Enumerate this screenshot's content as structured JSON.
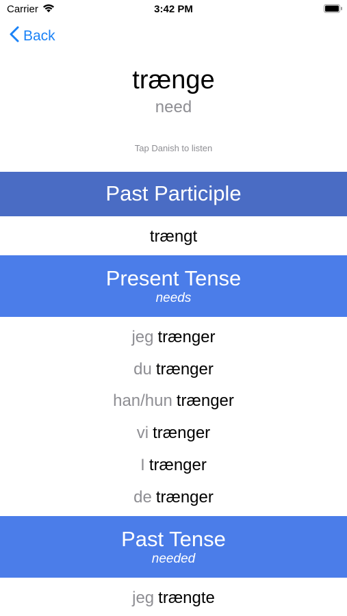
{
  "status_bar": {
    "carrier": "Carrier",
    "time": "3:42 PM"
  },
  "nav": {
    "back_label": "Back",
    "accent_color": "#1a82f7"
  },
  "word": {
    "danish": "trænge",
    "english": "need",
    "hint": "Tap Danish to listen"
  },
  "past_participle": {
    "title": "Past Participle",
    "form": "trængt"
  },
  "present_tense": {
    "title": "Present Tense",
    "english": "needs",
    "rows": [
      {
        "pronoun": "jeg",
        "form": "trænger"
      },
      {
        "pronoun": "du",
        "form": "trænger"
      },
      {
        "pronoun": "han/hun",
        "form": "trænger"
      },
      {
        "pronoun": "vi",
        "form": "trænger"
      },
      {
        "pronoun": "I",
        "form": "trænger"
      },
      {
        "pronoun": "de",
        "form": "trænger"
      }
    ]
  },
  "past_tense": {
    "title": "Past Tense",
    "english": "needed",
    "rows": [
      {
        "pronoun": "jeg",
        "form": "trængte"
      }
    ]
  },
  "colors": {
    "participle_header": "#4a6cc4",
    "tense_header": "#4b7de9",
    "pronoun_gray": "#8e8e93"
  }
}
